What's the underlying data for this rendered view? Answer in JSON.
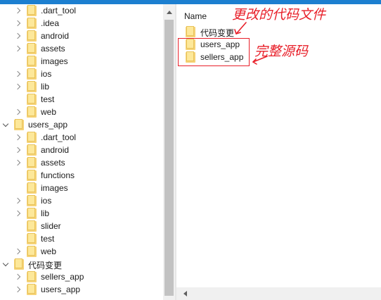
{
  "tree": {
    "items": [
      {
        "label": ".dart_tool",
        "level": 1,
        "state": "collapsed"
      },
      {
        "label": ".idea",
        "level": 1,
        "state": "collapsed"
      },
      {
        "label": "android",
        "level": 1,
        "state": "collapsed"
      },
      {
        "label": "assets",
        "level": 1,
        "state": "collapsed"
      },
      {
        "label": "images",
        "level": 1,
        "state": "none"
      },
      {
        "label": "ios",
        "level": 1,
        "state": "collapsed"
      },
      {
        "label": "lib",
        "level": 1,
        "state": "collapsed"
      },
      {
        "label": "test",
        "level": 1,
        "state": "none"
      },
      {
        "label": "web",
        "level": 1,
        "state": "collapsed"
      },
      {
        "label": "users_app",
        "level": 0,
        "state": "expanded"
      },
      {
        "label": ".dart_tool",
        "level": 1,
        "state": "collapsed"
      },
      {
        "label": "android",
        "level": 1,
        "state": "collapsed"
      },
      {
        "label": "assets",
        "level": 1,
        "state": "collapsed"
      },
      {
        "label": "functions",
        "level": 1,
        "state": "none"
      },
      {
        "label": "images",
        "level": 1,
        "state": "none"
      },
      {
        "label": "ios",
        "level": 1,
        "state": "collapsed"
      },
      {
        "label": "lib",
        "level": 1,
        "state": "collapsed"
      },
      {
        "label": "slider",
        "level": 1,
        "state": "none"
      },
      {
        "label": "test",
        "level": 1,
        "state": "none"
      },
      {
        "label": "web",
        "level": 1,
        "state": "collapsed"
      },
      {
        "label": "代码变更",
        "level": 0,
        "state": "expanded"
      },
      {
        "label": "sellers_app",
        "level": 1,
        "state": "collapsed"
      },
      {
        "label": "users_app",
        "level": 1,
        "state": "collapsed"
      }
    ]
  },
  "content": {
    "column_header": "Name",
    "items": [
      {
        "label": "代码变更"
      },
      {
        "label": "users_app"
      },
      {
        "label": "sellers_app"
      }
    ]
  },
  "annotations": {
    "changed_code_files": "更改的代码文件",
    "complete_source_code": "完整源码",
    "color": "#e8202a"
  },
  "colors": {
    "folder_fill": "#fde89a",
    "folder_back": "#f6d376",
    "title_bar": "#1c7fd0",
    "annotation": "#e8202a"
  }
}
